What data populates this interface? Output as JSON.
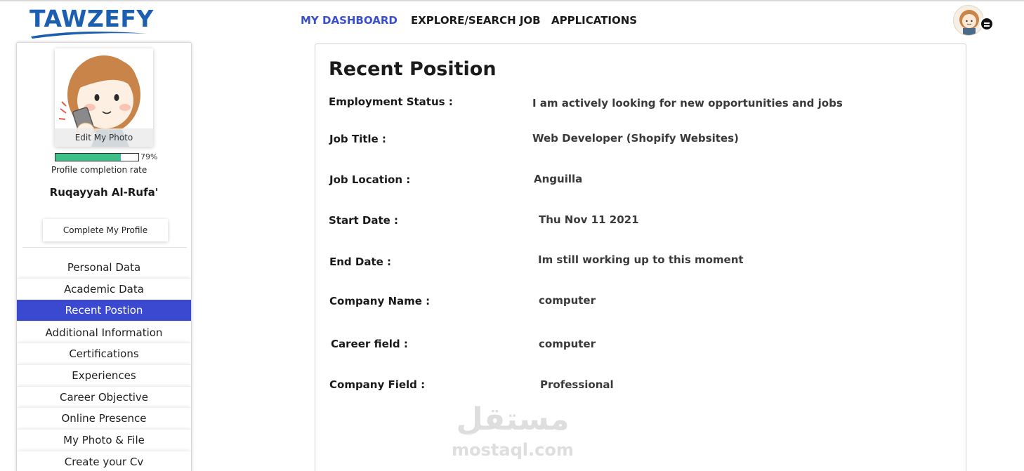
{
  "brand": {
    "logo_text": "TAWZEFY",
    "color": "#1c5fb0"
  },
  "nav": {
    "items": [
      {
        "label": "MY DASHBOARD",
        "active": true
      },
      {
        "label": "EXPLORE/SEARCH JOB",
        "active": false
      },
      {
        "label": "APPLICATIONS",
        "active": false
      }
    ],
    "active_color": "#3a4fd0"
  },
  "header": {
    "avatar_icon": "user-avatar",
    "menu_icon": "menu-icon"
  },
  "sidebar": {
    "edit_photo_label": "Edit My Photo",
    "completion_percent": 79,
    "completion_text": "79%",
    "completion_label": "Profile completion rate",
    "user_name": "Ruqayyah Al-Rufa'",
    "complete_profile_label": "Complete My Profile",
    "menu": [
      {
        "label": "Personal Data"
      },
      {
        "label": "Academic Data"
      },
      {
        "label": "Recent Postion",
        "active": true
      },
      {
        "label": "Additional Information"
      },
      {
        "label": "Certifications"
      },
      {
        "label": "Experiences"
      },
      {
        "label": "Career Objective"
      },
      {
        "label": "Online Presence"
      },
      {
        "label": "My Photo & File"
      },
      {
        "label": "Create your Cv"
      }
    ],
    "active_color": "#3b49d1",
    "progress_color": "#3dbf8a"
  },
  "main": {
    "title": "Recent Position",
    "fields": [
      {
        "label": "Employment Status :",
        "value": "I am actively looking for new opportunities and jobs"
      },
      {
        "label": "Job Title  :",
        "value": "Web Developer (Shopify Websites)"
      },
      {
        "label": "Job Location :",
        "value": "Anguilla"
      },
      {
        "label": "Start Date :",
        "value": "Thu Nov 11 2021"
      },
      {
        "label": "End Date :",
        "value": "Im still working up to this moment"
      },
      {
        "label": "Company Name :",
        "value": "computer"
      },
      {
        "label": "Career field :",
        "value": "computer"
      },
      {
        "label": "Company Field :",
        "value": "Professional"
      }
    ]
  },
  "watermark": {
    "arabic": "مستقل",
    "latin": "mostaql.com"
  }
}
